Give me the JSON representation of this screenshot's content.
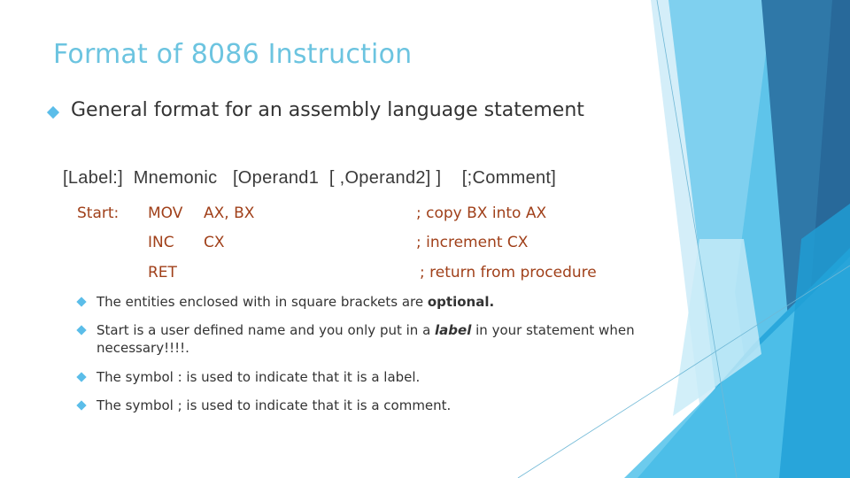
{
  "slide": {
    "title": "Format of 8086 Instruction",
    "main_bullet": "General format for an assembly language statement",
    "syntax": "[Label:]  Mnemonic   [Operand1  [ ,Operand2] ]    [;Comment]",
    "code_lines": [
      {
        "label": "Start:",
        "mnemonic": "MOV",
        "operands": "AX, BX",
        "comment": "; copy BX into AX"
      },
      {
        "label": "",
        "mnemonic": "INC",
        "operands": "CX",
        "comment": "; increment CX"
      },
      {
        "label": "",
        "mnemonic": "RET",
        "operands": "",
        "comment": "; return from procedure"
      }
    ],
    "notes": [
      {
        "pre": "The entities enclosed with in square brackets are ",
        "em": "optional.",
        "post": ""
      },
      {
        "pre": "Start is a user defined name and you only put in a  ",
        "em": "label",
        "post": " in your statement when necessary!!!!."
      },
      {
        "pre": "The symbol : is used to indicate that it is a label.",
        "em": "",
        "post": ""
      },
      {
        "pre": "The symbol ; is used to indicate that it is a comment.",
        "em": "",
        "post": ""
      }
    ]
  },
  "theme": {
    "title_color": "#6cc4e0",
    "bullet_color": "#5bbde9",
    "code_color": "#a0401a",
    "text_color": "#333333"
  }
}
